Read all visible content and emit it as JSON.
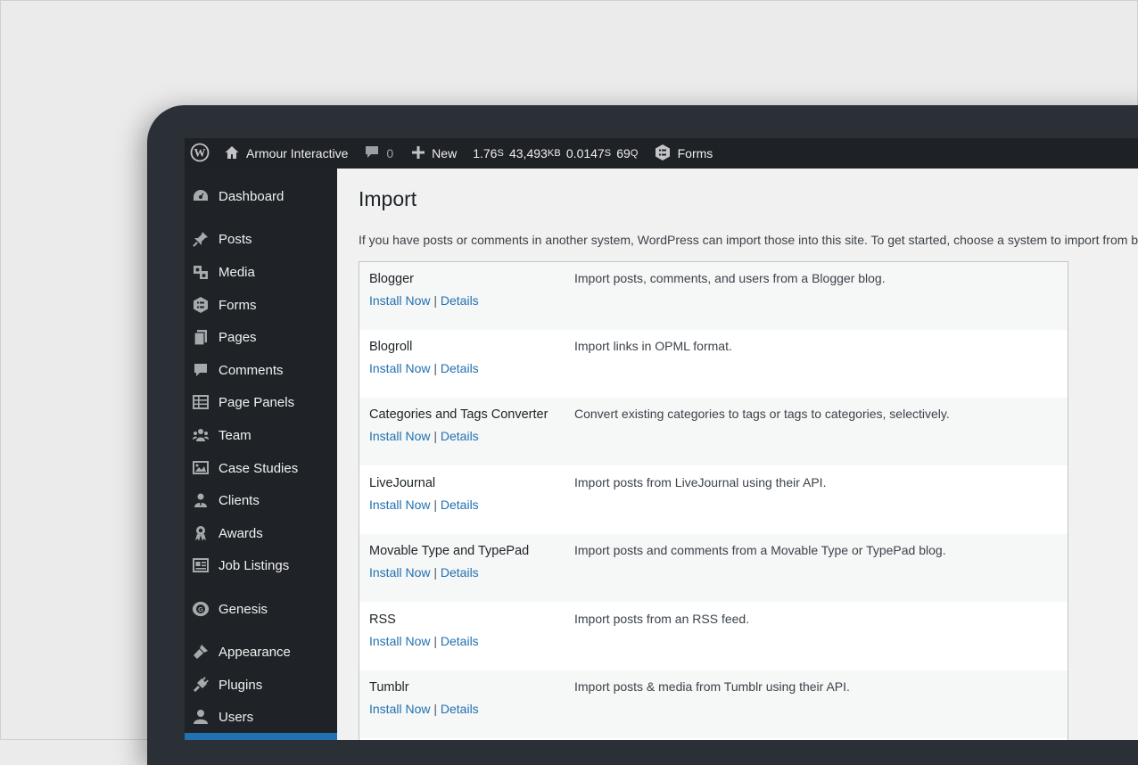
{
  "adminbar": {
    "site_name": "Armour Interactive",
    "comments_count": "0",
    "new_label": "New",
    "stats": [
      {
        "value": "1.76",
        "unit": "S"
      },
      {
        "value": "43,493",
        "unit": "KB"
      },
      {
        "value": "0.0147",
        "unit": "S"
      },
      {
        "value": "69",
        "unit": "Q"
      }
    ],
    "forms_label": "Forms"
  },
  "sidebar": {
    "items": [
      {
        "label": "Dashboard",
        "icon": "dashboard-icon"
      },
      {
        "label": "Posts",
        "icon": "pin-icon"
      },
      {
        "label": "Media",
        "icon": "media-icon"
      },
      {
        "label": "Forms",
        "icon": "forms-icon"
      },
      {
        "label": "Pages",
        "icon": "pages-icon"
      },
      {
        "label": "Comments",
        "icon": "comment-icon"
      },
      {
        "label": "Page Panels",
        "icon": "table-icon"
      },
      {
        "label": "Team",
        "icon": "team-icon"
      },
      {
        "label": "Case Studies",
        "icon": "gallery-icon"
      },
      {
        "label": "Clients",
        "icon": "businessperson-icon"
      },
      {
        "label": "Awards",
        "icon": "award-icon"
      },
      {
        "label": "Job Listings",
        "icon": "id-card-icon"
      },
      {
        "label": "Genesis",
        "icon": "genesis-icon"
      },
      {
        "label": "Appearance",
        "icon": "brush-icon"
      },
      {
        "label": "Plugins",
        "icon": "plugin-icon"
      },
      {
        "label": "Users",
        "icon": "user-icon"
      }
    ]
  },
  "main": {
    "title": "Import",
    "intro": "If you have posts or comments in another system, WordPress can import those into this site. To get started, choose a system to import from below:",
    "install_label": "Install Now",
    "separator": "|",
    "details_label": "Details",
    "importers": [
      {
        "name": "Blogger",
        "description": "Import posts, comments, and users from a Blogger blog."
      },
      {
        "name": "Blogroll",
        "description": "Import links in OPML format."
      },
      {
        "name": "Categories and Tags Converter",
        "description": "Convert existing categories to tags or tags to categories, selectively."
      },
      {
        "name": "LiveJournal",
        "description": "Import posts from LiveJournal using their API."
      },
      {
        "name": "Movable Type and TypePad",
        "description": "Import posts and comments from a Movable Type or TypePad blog."
      },
      {
        "name": "RSS",
        "description": "Import posts from an RSS feed."
      },
      {
        "name": "Tumblr",
        "description": "Import posts & media from Tumblr using their API."
      }
    ]
  },
  "colors": {
    "accent": "#2271b1",
    "sidebar_bg": "#1f2327",
    "adminbar_bg": "#1e2125"
  }
}
